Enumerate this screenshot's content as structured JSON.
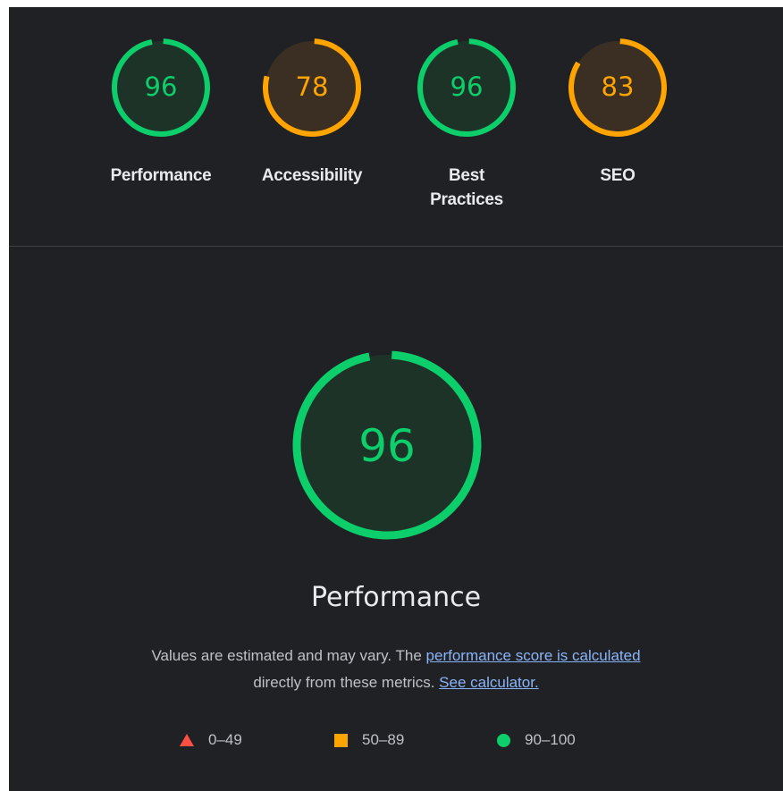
{
  "colors": {
    "background": "#202124",
    "pass": "#0cce6b",
    "average": "#ffa400",
    "fail": "#ff4e42",
    "link": "#8ab4f8",
    "text": "#e8eaed",
    "muted_text": "#bdc1c6"
  },
  "gauges": [
    {
      "score": "96",
      "label": "Performance",
      "rating": "pass"
    },
    {
      "score": "78",
      "label": "Accessibility",
      "rating": "average"
    },
    {
      "score": "96",
      "label": "Best Practices",
      "rating": "pass"
    },
    {
      "score": "83",
      "label": "SEO",
      "rating": "average"
    }
  ],
  "main": {
    "score": "96",
    "title": "Performance",
    "rating": "pass",
    "description": {
      "text_before": "Values are estimated and may vary. The ",
      "link1": "performance score is calculated",
      "text_middle": " directly from these metrics. ",
      "link2": "See calculator."
    }
  },
  "legend": [
    {
      "shape": "triangle",
      "range": "0–49"
    },
    {
      "shape": "square",
      "range": "50–89"
    },
    {
      "shape": "circle",
      "range": "90–100"
    }
  ]
}
